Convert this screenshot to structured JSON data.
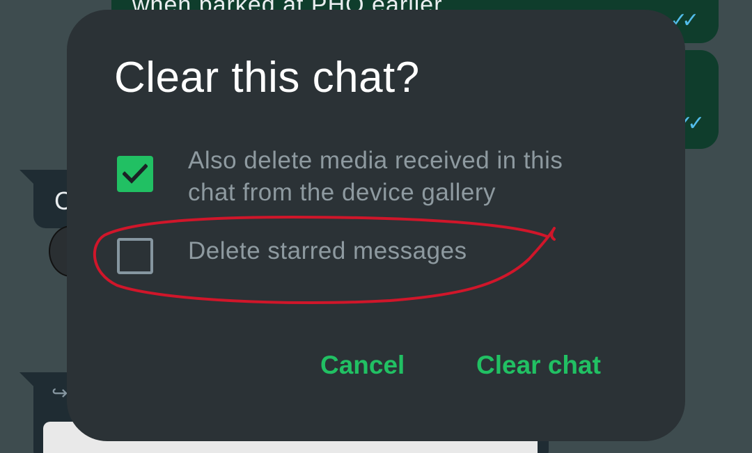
{
  "background": {
    "bubble_text": "when parked at PHQ earlier",
    "incoming_initial": "C",
    "forward_icon": "forward-icon",
    "read_receipt_icon": "double-check-icon"
  },
  "dialog": {
    "title": "Clear this chat?",
    "options": [
      {
        "label": "Also delete media received in this chat from the device gallery",
        "checked": true
      },
      {
        "label": "Delete starred messages",
        "checked": false
      }
    ],
    "cancel_label": "Cancel",
    "confirm_label": "Clear chat"
  },
  "colors": {
    "accent": "#21c063",
    "dialog_bg": "#2b3236",
    "annotation": "#d0162a"
  }
}
